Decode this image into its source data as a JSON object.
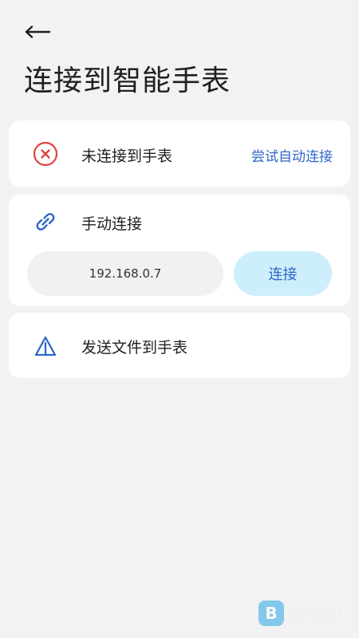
{
  "header": {
    "back_icon": "arrow-left-icon",
    "title": "连接到智能手表"
  },
  "status_card": {
    "icon": "disconnected-x-icon",
    "status_text": "未连接到手表",
    "action_label": "尝试自动连接",
    "icon_color": "#e0443e"
  },
  "manual_card": {
    "icon": "link-icon",
    "title": "手动连接",
    "ip_value": "192.168.0.7",
    "connect_label": "连接",
    "accent_color": "#2f67c9"
  },
  "send_card": {
    "icon": "send-triangle-icon",
    "label": "发送文件到手表"
  },
  "watermark": {
    "text": "灵宝软件"
  }
}
